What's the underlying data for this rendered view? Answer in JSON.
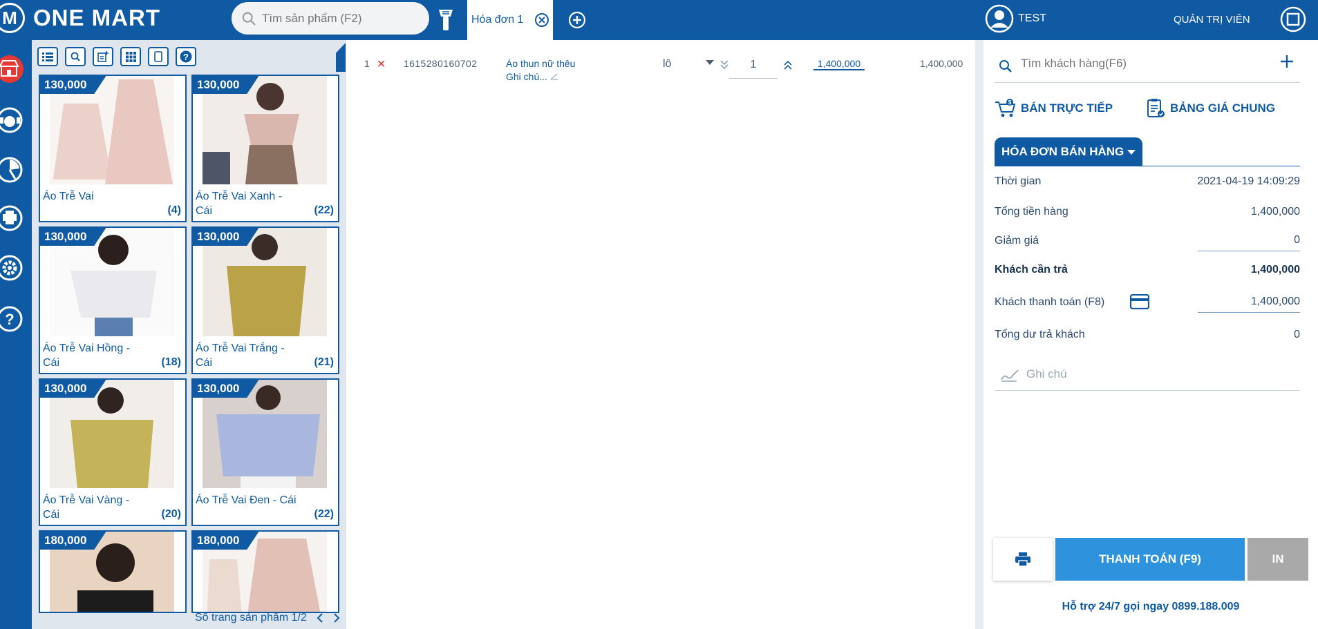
{
  "brand": {
    "logo_letter": "M",
    "name": "ONE MART"
  },
  "topbar": {
    "search_placeholder": "Tìm sản phẩm (F2)",
    "active_tab": "Hóa đơn 1",
    "user_name": "TEST",
    "role": "QUẢN TRỊ VIÊN"
  },
  "colors": {
    "primary": "#0f5aa2",
    "pay_button": "#2e93dc",
    "danger": "#e53935",
    "print_button_bg": "#a9a9a9"
  },
  "nav_icons": [
    "store-icon",
    "customer-support-icon",
    "report-icon",
    "printer-icon",
    "settings-icon",
    "help-icon"
  ],
  "products": [
    {
      "price": "130,000",
      "name": "Áo Trễ Vai",
      "qty": "(4)",
      "image_color": "#e8c8c0"
    },
    {
      "price": "130,000",
      "name": "Áo Trễ Vai Xanh - Cái",
      "qty": "(22)",
      "image_color": "#d9b7ae"
    },
    {
      "price": "130,000",
      "name": "Áo Trễ Vai Hồng - Cái",
      "qty": "(18)",
      "image_color": "#e9e9ee"
    },
    {
      "price": "130,000",
      "name": "Áo Trễ Vai Trắng - Cái",
      "qty": "(21)",
      "image_color": "#b9a247"
    },
    {
      "price": "130,000",
      "name": "Áo Trễ Vai Vàng - Cái",
      "qty": "(20)",
      "image_color": "#c4b359"
    },
    {
      "price": "130,000",
      "name": "Áo Trễ Vai Đen - Cái",
      "qty": "(22)",
      "image_color": "#a9b6de"
    },
    {
      "price": "180,000",
      "name": "",
      "qty": "",
      "image_color": "#e8d4c0"
    },
    {
      "price": "180,000",
      "name": "",
      "qty": "",
      "image_color": "#e3c0b5"
    }
  ],
  "pager": {
    "label": "Số trang sản phẩm 1/2"
  },
  "order_line": {
    "index": "1",
    "code": "1615280160702",
    "name": "Áo thun nữ thêu",
    "note": "Ghi chú...",
    "unit": "lô",
    "qty": "1",
    "price": "1,400,000",
    "total": "1,400,000"
  },
  "customer": {
    "search_placeholder": "Tìm khách hàng(F6)"
  },
  "modes": {
    "direct": "BÁN TRỰC TIẾP",
    "price_list": "BẢNG GIÁ CHUNG"
  },
  "invoice": {
    "tab_label": "HÓA ĐƠN BÁN HÀNG",
    "time_label": "Thời gian",
    "time_value": "2021-04-19 14:09:29",
    "subtotal_label": "Tổng tiền hàng",
    "subtotal_value": "1,400,000",
    "discount_label": "Giảm giá",
    "discount_value": "0",
    "due_label": "Khách cần trả",
    "due_value": "1,400,000",
    "paid_label": "Khách thanh toán (F8)",
    "paid_value": "1,400,000",
    "change_label": "Tổng dư trả khách",
    "change_value": "0",
    "note_placeholder": "Ghi chú"
  },
  "actions": {
    "pay_label": "THANH TOÁN (F9)",
    "print_label": "IN"
  },
  "support": "Hỗ trợ 24/7 gọi ngay 0899.188.009"
}
